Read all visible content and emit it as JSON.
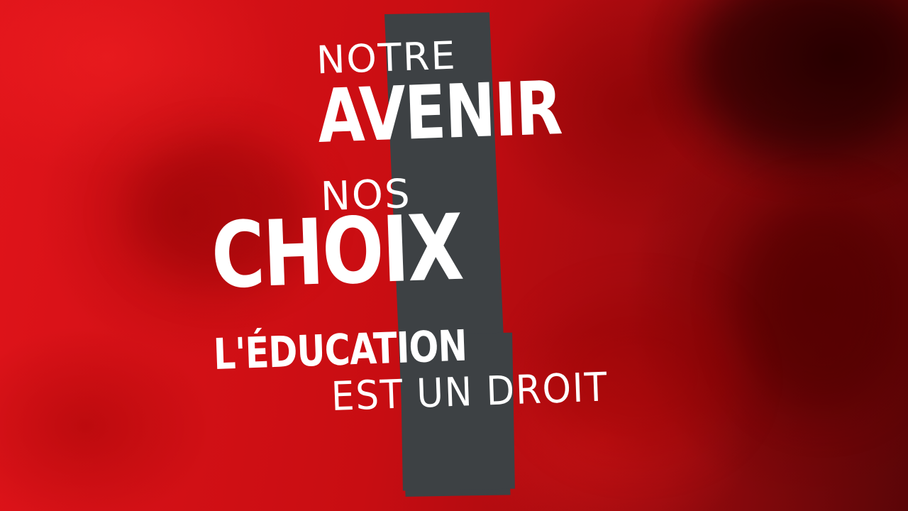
{
  "poster": {
    "line1": "NOTRE",
    "line2": "AVENIR",
    "line3": "NOS",
    "line4": "CHOIX",
    "line5": "L'ÉDUCATION",
    "line6": "EST UN DROIT"
  },
  "colors": {
    "background": "#d40f12",
    "bar": "#3d4144",
    "text": "#ffffff"
  }
}
